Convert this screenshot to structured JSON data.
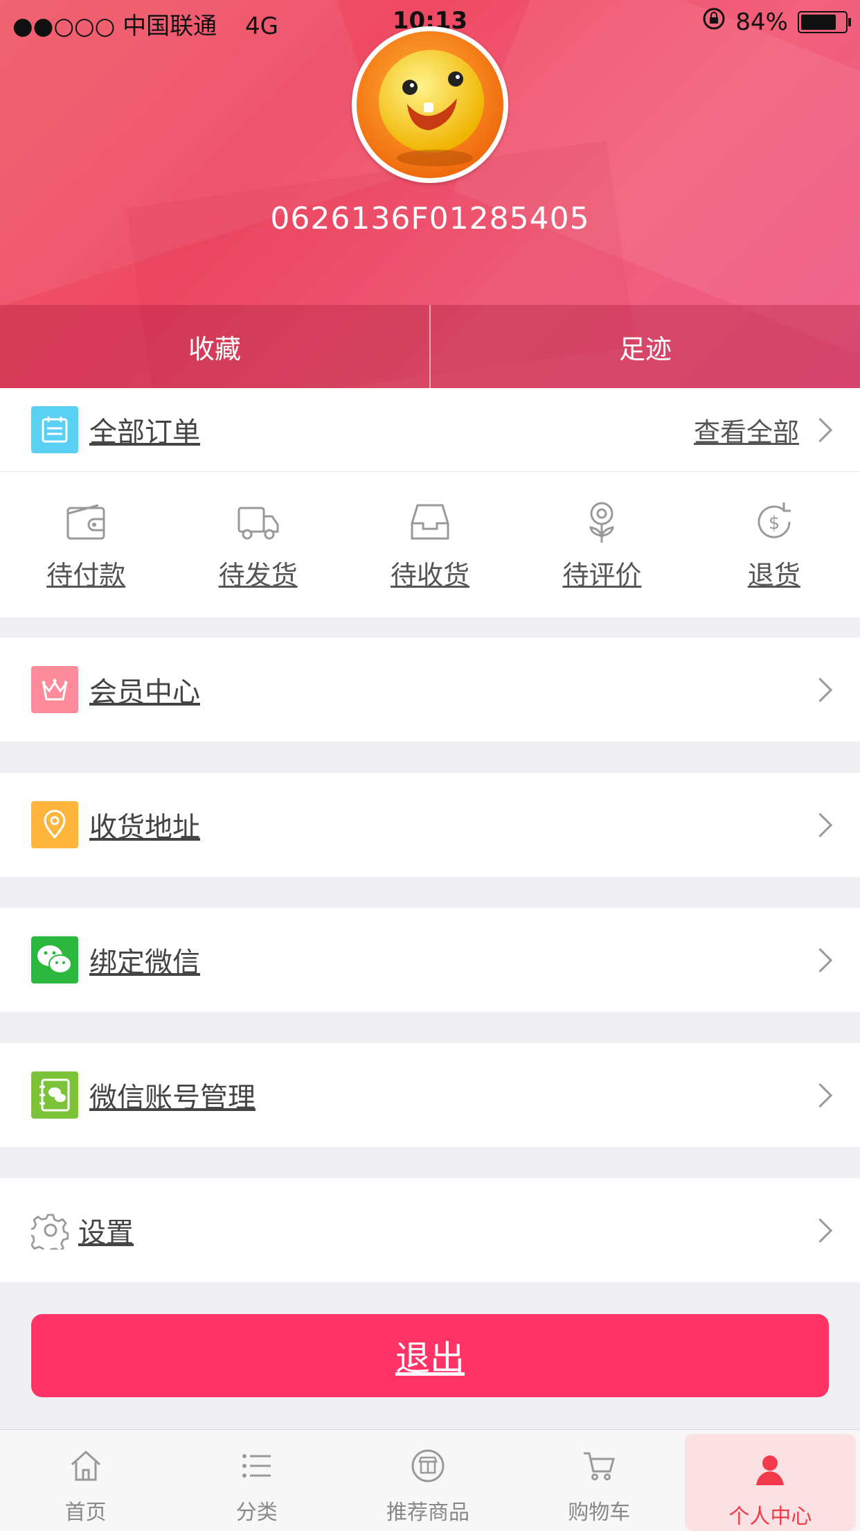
{
  "status": {
    "carrier": "●●○○○ 中国联通",
    "network": "4G",
    "time": "10:13",
    "battery": "84%",
    "battery_level": 0.84
  },
  "profile": {
    "username": "0626136F01285405"
  },
  "quick_tabs": {
    "favorites": "收藏",
    "footprints": "足迹"
  },
  "orders": {
    "title": "全部订单",
    "view_all": "查看全部",
    "items": [
      {
        "label": "待付款",
        "icon": "wallet-icon"
      },
      {
        "label": "待发货",
        "icon": "truck-icon"
      },
      {
        "label": "待收货",
        "icon": "inbox-icon"
      },
      {
        "label": "待评价",
        "icon": "flower-icon"
      },
      {
        "label": "退货",
        "icon": "refund-icon"
      }
    ]
  },
  "menu": {
    "member": "会员中心",
    "address": "收货地址",
    "bind_wechat": "绑定微信",
    "wechat_account": "微信账号管理",
    "settings": "设置"
  },
  "colors": {
    "accent": "#ff3366",
    "tab_active": "#f23a4a"
  },
  "logout": "退出",
  "tabbar": {
    "items": [
      {
        "label": "首页",
        "icon": "home-icon"
      },
      {
        "label": "分类",
        "icon": "list-icon"
      },
      {
        "label": "推荐商品",
        "icon": "store-icon"
      },
      {
        "label": "购物车",
        "icon": "cart-icon"
      },
      {
        "label": "个人中心",
        "icon": "person-icon"
      }
    ]
  }
}
